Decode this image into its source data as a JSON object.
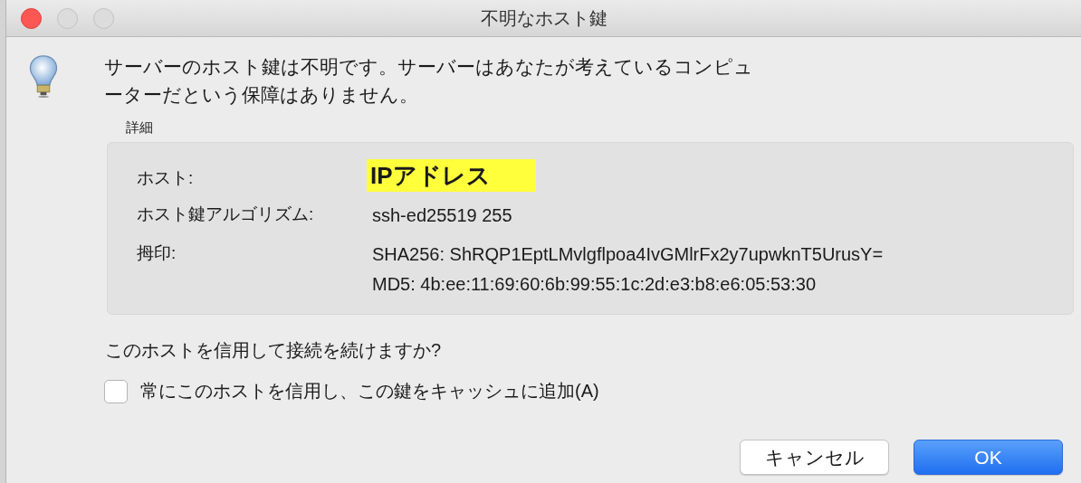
{
  "window": {
    "title": "不明なホスト鍵"
  },
  "message": [
    "サーバーのホスト鍵は不明です。サーバーはあなたが考えているコンピュ",
    "ーターだという保障はありません。"
  ],
  "details": {
    "label": "詳細",
    "rows": [
      {
        "label": "ホスト:",
        "values": [
          "IPアドレス"
        ],
        "highlighted": true
      },
      {
        "label": "ホスト鍵アルゴリズム:",
        "values": [
          "ssh-ed25519 255"
        ],
        "highlighted": false
      },
      {
        "label": "拇印:",
        "values": [
          "SHA256: ShRQP1EptLMvlgflpoa4IvGMlrFx2y7upwknT5UrusY=",
          "MD5: 4b:ee:11:69:60:6b:99:55:1c:2d:e3:b8:e6:05:53:30"
        ],
        "highlighted": false
      }
    ]
  },
  "question": "このホストを信用して接続を続けますか?",
  "checkbox": {
    "label": "常にこのホストを信用し、この鍵をキャッシュに追加(A)",
    "checked": false
  },
  "buttons": [
    {
      "label": "キャンセル",
      "default": false
    },
    {
      "label": "OK",
      "default": true
    }
  ]
}
